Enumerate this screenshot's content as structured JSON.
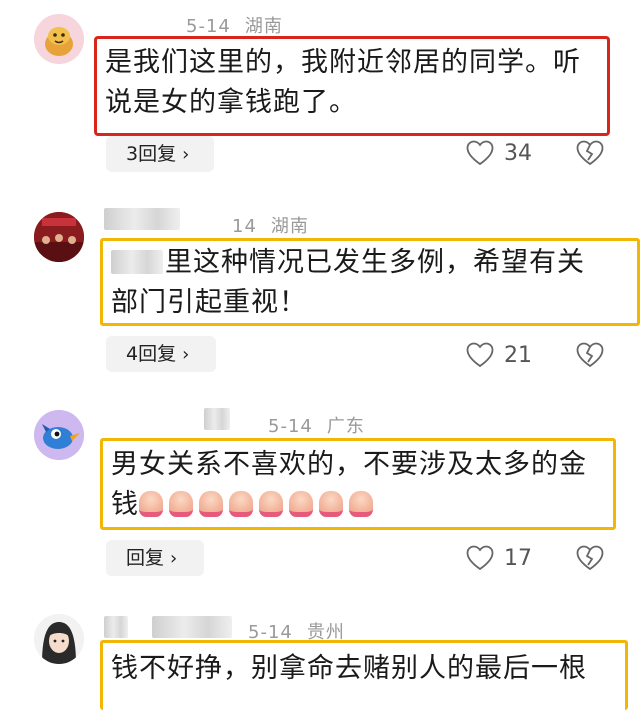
{
  "comments": [
    {
      "date": "5-14",
      "region": "湖南",
      "text_lines": [
        "是我们这里的，我附近邻居的同学。听",
        "说是女的拿钱跑了。"
      ],
      "reply_label": "3回复",
      "likes": "34",
      "avatar_icon": "cartoon-avatar-icon"
    },
    {
      "date": "14",
      "region": "湖南",
      "text_lines": [
        "里这种情况已发生多例，希望有关",
        "部门引起重视！"
      ],
      "reply_label": "4回复",
      "likes": "21",
      "avatar_icon": "photo-avatar-icon"
    },
    {
      "date": "5-14",
      "region": "广东",
      "text_lines": [
        "男女关系不喜欢的，不要涉及太多的金",
        "钱"
      ],
      "reply_label": "回复",
      "likes": "17",
      "avatar_icon": "bird-avatar-icon"
    },
    {
      "date": "5-14",
      "region": "贵州",
      "text_lines": [
        "钱不好挣，别拿命去赌别人的最后一根"
      ],
      "avatar_icon": "girl-avatar-icon"
    }
  ],
  "colors": {
    "highlight_red": "#d9261c",
    "highlight_gold": "#f2b705",
    "meta_gray": "#9a9a9a"
  }
}
